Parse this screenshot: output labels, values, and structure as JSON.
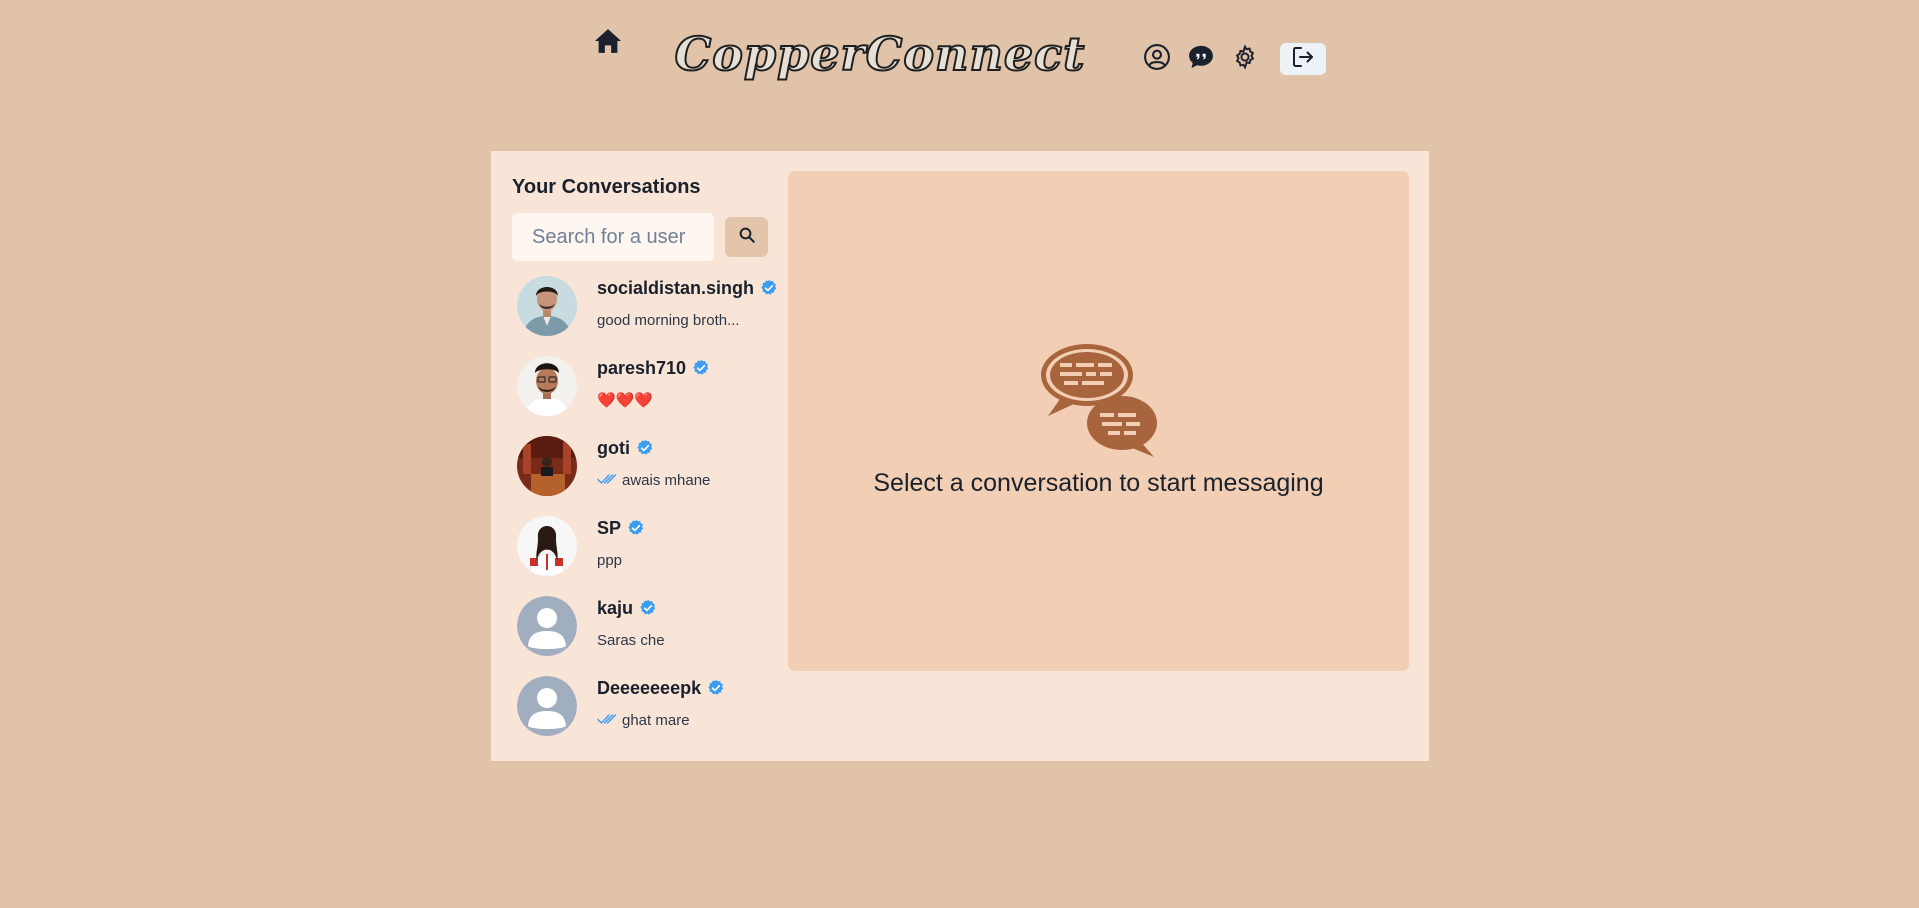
{
  "header": {
    "logo_text": "CopperConnect",
    "icons": [
      "home-icon",
      "user-circle-icon",
      "chat-quote-icon",
      "gear-icon",
      "logout-icon"
    ]
  },
  "sidebar": {
    "title": "Your Conversations",
    "search": {
      "placeholder": "Search for a user",
      "value": "",
      "button_icon": "search-icon"
    },
    "conversations": [
      {
        "name": "socialdistan.singh",
        "verified": true,
        "last_message": "good morning broth...",
        "seen": false
      },
      {
        "name": "paresh710",
        "verified": true,
        "last_message": "❤️❤️❤️",
        "seen": false
      },
      {
        "name": "goti",
        "verified": true,
        "last_message": "awais mhane",
        "seen": true
      },
      {
        "name": "SP",
        "verified": true,
        "last_message": "ppp",
        "seen": false
      },
      {
        "name": "kaju",
        "verified": true,
        "last_message": "Saras che",
        "seen": false
      },
      {
        "name": "Deeeeeeepk",
        "verified": true,
        "last_message": "ghat mare",
        "seen": true
      }
    ]
  },
  "main": {
    "empty_icon": "conversation-bubbles-icon",
    "empty_text": "Select a conversation to start messaging"
  },
  "colors": {
    "page_background": "#e0c3a8",
    "card_background": "#f8e5d7",
    "panel_background": "#f2cfb4",
    "accent_brown": "#a8643d",
    "verified_blue": "#3b9cf0"
  }
}
